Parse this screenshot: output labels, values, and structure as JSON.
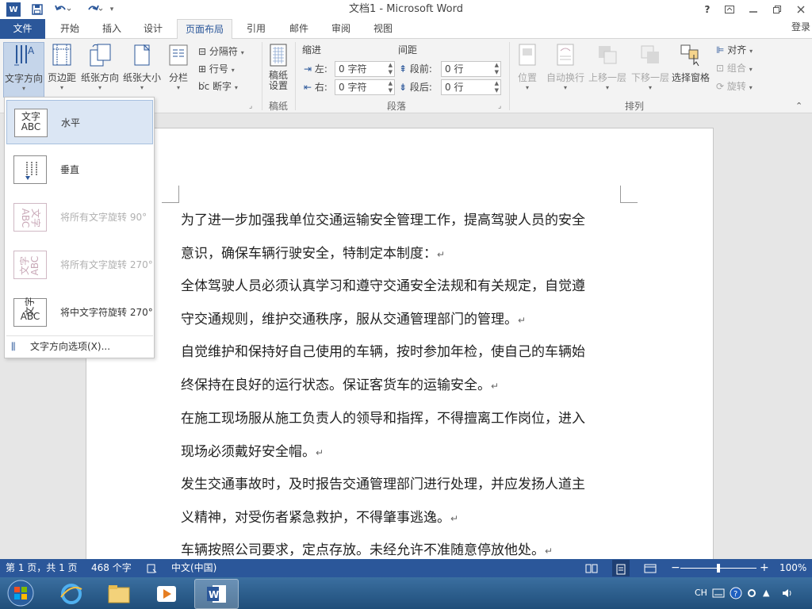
{
  "window": {
    "title": "文档1 - Microsoft Word",
    "help": "?",
    "login": "登录"
  },
  "tabs": [
    {
      "label": "文件"
    },
    {
      "label": "开始"
    },
    {
      "label": "插入"
    },
    {
      "label": "设计"
    },
    {
      "label": "页面布局"
    },
    {
      "label": "引用"
    },
    {
      "label": "邮件"
    },
    {
      "label": "审阅"
    },
    {
      "label": "视图"
    }
  ],
  "ribbon": {
    "page_setup": {
      "text_direction": "文字方向",
      "margins": "页边距",
      "orientation": "纸张方向",
      "size": "纸张大小",
      "columns": "分栏",
      "breaks": "分隔符",
      "line_numbers": "行号",
      "hyphenation": "断字"
    },
    "draft": {
      "label_line1": "稿纸",
      "label_line2": "设置",
      "group": "稿纸"
    },
    "paragraph": {
      "indent_title": "缩进",
      "spacing_title": "间距",
      "left_label": "左:",
      "right_label": "右:",
      "before_label": "段前:",
      "after_label": "段后:",
      "left_value": "0 字符",
      "right_value": "0 字符",
      "before_value": "0 行",
      "after_value": "0 行",
      "group": "段落"
    },
    "arrange": {
      "position": "位置",
      "wrap_text": "自动换行",
      "bring_forward": "上移一层",
      "send_backward": "下移一层",
      "selection_pane": "选择窗格",
      "align": "对齐",
      "group_objects": "组合",
      "rotate": "旋转",
      "group": "排列"
    }
  },
  "dropdown": {
    "items": [
      {
        "label": "水平",
        "icon_text": "文字ABC"
      },
      {
        "label": "垂直",
        "icon_text": ""
      },
      {
        "label": "将所有文字旋转 90°",
        "icon_text": "文字ABC"
      },
      {
        "label": "将所有文字旋转 270°",
        "icon_text": "文字ABC"
      },
      {
        "label": "将中文字符旋转 270°",
        "icon_text": "文字ABC"
      }
    ],
    "options": "文字方向选项(X)..."
  },
  "document": {
    "lines": [
      "为了进一步加强我单位交通运输安全管理工作，提高驾驶人员的安全",
      "意识，确保车辆行驶安全，特制定本制度：",
      "全体驾驶人员必须认真学习和遵守交通安全法规和有关规定，自觉遵",
      "守交通规则，维护交通秩序，服从交通管理部门的管理。",
      "自觉维护和保持好自己使用的车辆，按时参加年检，使自己的车辆始",
      "终保持在良好的运行状态。保证客货车的运输安全。",
      "在施工现场服从施工负责人的领导和指挥，不得擅离工作岗位，进入",
      "现场必须戴好安全帽。",
      "发生交通事故时，及时报告交通管理部门进行处理，并应发扬人道主",
      "义精神，对受伤者紧急救护，不得肇事逃逸。",
      "车辆按照公司要求，定点存放。未经允许不准随意停放他处。"
    ],
    "para_mark": "↵"
  },
  "status": {
    "page": "第 1 页，共 1 页",
    "words": "468 个字",
    "language": "中文(中国)",
    "zoom_minus": "−",
    "zoom_plus": "+",
    "zoom": "100%",
    "zoom_level": 100
  },
  "taskbar": {
    "ime": "CH"
  },
  "colors": {
    "accent": "#2b579a",
    "ribbon_bg": "#f3f3f3",
    "doc_bg": "#e6e6e6"
  }
}
